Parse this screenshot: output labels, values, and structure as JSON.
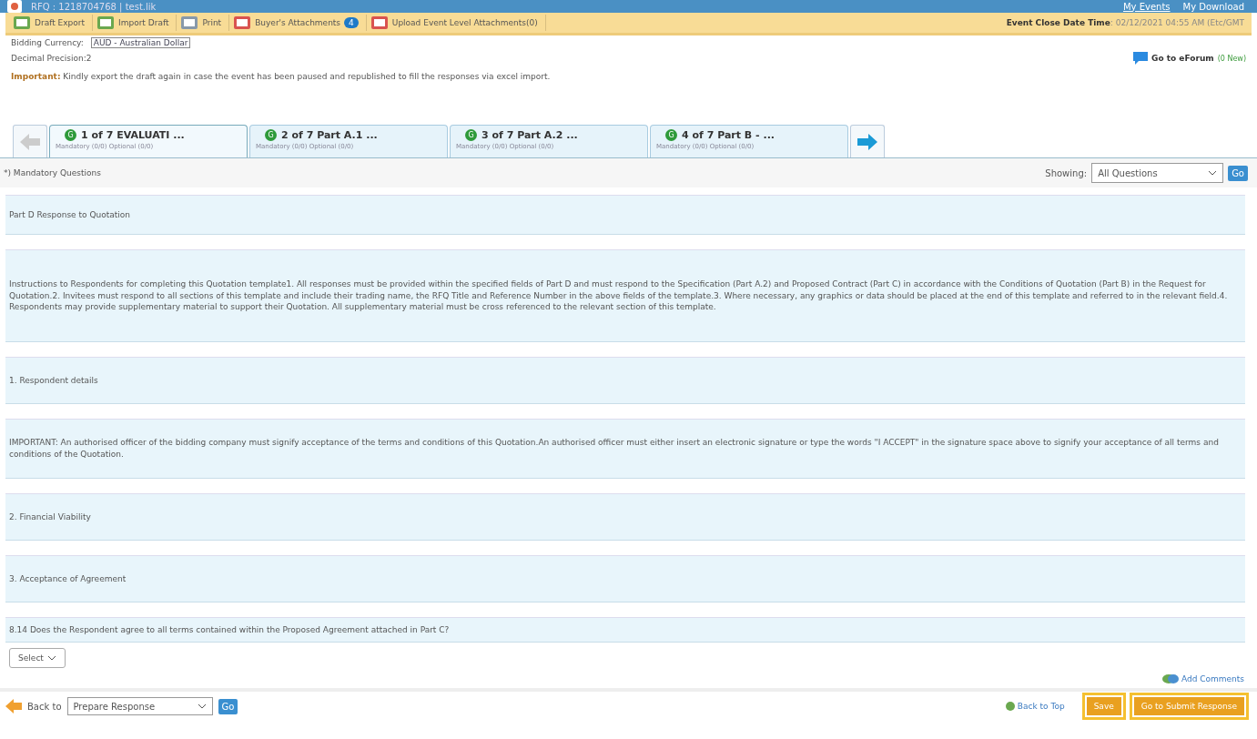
{
  "window": {
    "title": "RFQ : 1218704768 | test.lik",
    "links": [
      {
        "label": "My Events",
        "underlined": true
      },
      {
        "label": "My Download",
        "underlined": false
      }
    ]
  },
  "toolbar": {
    "items": [
      {
        "label": "Draft Export",
        "kind": "export"
      },
      {
        "label": "Import Draft",
        "kind": "import"
      },
      {
        "label": "Print",
        "kind": "print"
      },
      {
        "label": "Buyer's Attachments",
        "kind": "attach",
        "badge": "4"
      },
      {
        "label": "Upload Event Level Attachments(0)",
        "kind": "attach"
      }
    ],
    "close_label": "Event Close Date Time",
    "close_value": ": 02/12/2021 04:55 AM  (Etc/GMT"
  },
  "currency": {
    "label": "Bidding Currency:",
    "value": "AUD - Australian Dollar"
  },
  "precision": "Decimal Precision:2",
  "forum": {
    "label": "Go to eForum",
    "count": "(0 New)"
  },
  "notice": {
    "label": "Important:",
    "text": "Kindly export the draft again in case the event has been paused and republished to fill the responses via excel import."
  },
  "tabs": [
    {
      "title": "1 of 7 EVALUATI ...",
      "sub": "Mandatory (0/0) Optional (0/0)",
      "badge": "G",
      "selected": true
    },
    {
      "title": "2 of 7 Part A.1 ...",
      "sub": "Mandatory (0/0) Optional (0/0)",
      "badge": "G",
      "selected": false
    },
    {
      "title": "3 of 7 Part A.2 ...",
      "sub": "Mandatory (0/0) Optional (0/0)",
      "badge": "G",
      "selected": false
    },
    {
      "title": "4 of 7 Part B - ...",
      "sub": "Mandatory (0/0) Optional (0/0)",
      "badge": "G",
      "selected": false
    }
  ],
  "filter": {
    "legend": "*) Mandatory Questions",
    "label": "Showing:",
    "value": "All Questions",
    "go": "Go"
  },
  "sections": [
    {
      "text": "Part D Response to Quotation"
    },
    {
      "text": "Instructions to Respondents for completing this Quotation template1.    All responses must be provided within the specified fields of Part D and must respond to the Specification (Part A.2) and Proposed Contract (Part C) in accordance with the Conditions of Quotation (Part B) in the Request for Quotation.2.    Invitees must respond to all sections of this template and include their trading name, the RFQ Title and Reference Number in the above fields of the template.3.    Where necessary, any graphics or data should be placed at the end of this template and referred to in the relevant field.4.    Respondents may provide supplementary material to support their Quotation.  All supplementary material must be cross referenced to the relevant section of this template."
    },
    {
      "text": "1. Respondent details"
    },
    {
      "text": "IMPORTANT: An authorised officer of the bidding company must signify acceptance of the terms and conditions of this Quotation.An authorised officer must either insert an electronic signature or type the words \"I ACCEPT\" in the signature space above to signify your acceptance of all terms and conditions of the Quotation."
    },
    {
      "text": "2. Financial Viability"
    },
    {
      "text": "3. Acceptance of Agreement"
    }
  ],
  "question": {
    "text": "8.14 Does the Respondent agree to all terms contained within the Proposed Agreement attached in Part C?",
    "answer": "Select"
  },
  "add_comments": "Add Comments",
  "footer": {
    "back_label": "Back to",
    "back_value": "Prepare Response",
    "go": "Go",
    "top": "Back to Top",
    "save": "Save",
    "submit": "Go to Submit Response"
  }
}
